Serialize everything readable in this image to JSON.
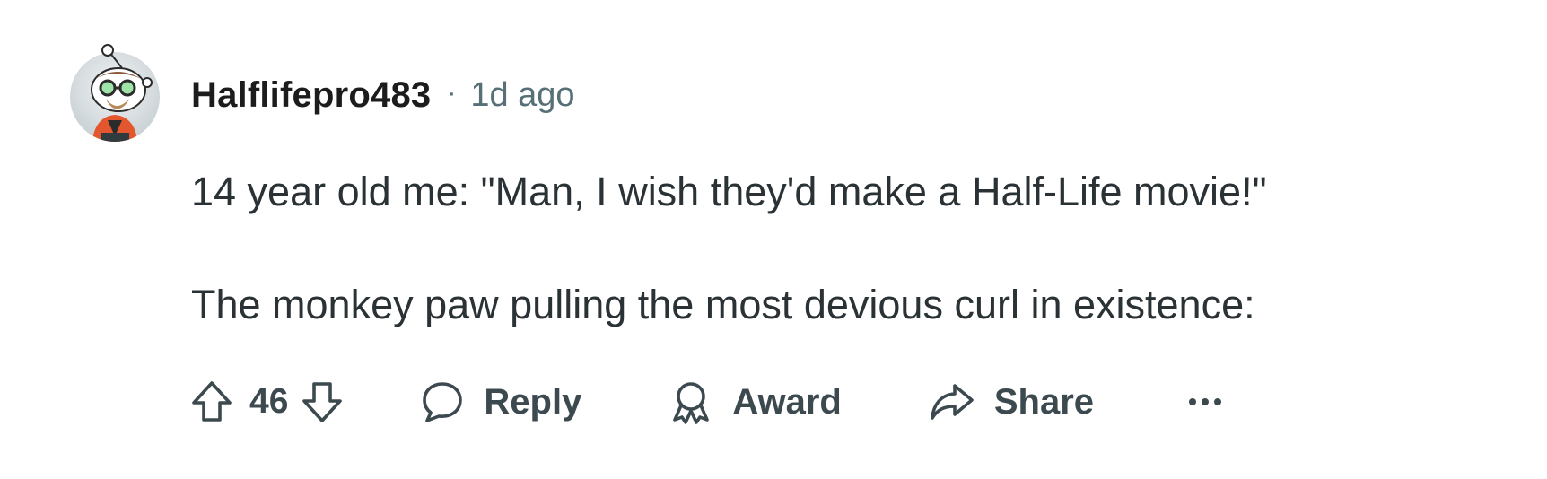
{
  "comment": {
    "author": "Halflifepro483",
    "separator": "·",
    "time": "1d ago",
    "paragraphs": [
      "14 year old me: \"Man, I wish they'd make a Half-Life movie!\"",
      "The monkey paw pulling the most devious curl in existence:"
    ],
    "avatar_icon": "snoo-avatar-icon"
  },
  "actions": {
    "upvote_icon": "arrow-up-icon",
    "vote_count": "46",
    "downvote_icon": "arrow-down-icon",
    "reply_label": "Reply",
    "reply_icon": "speech-bubble-icon",
    "award_label": "Award",
    "award_icon": "award-ribbon-icon",
    "share_label": "Share",
    "share_icon": "share-arrow-icon",
    "more_icon": "ellipsis-icon"
  },
  "colors": {
    "text_primary": "#1c1c1c",
    "text_body": "#2a3236",
    "text_meta": "#576f76",
    "icon_gray": "#3c4a50"
  }
}
